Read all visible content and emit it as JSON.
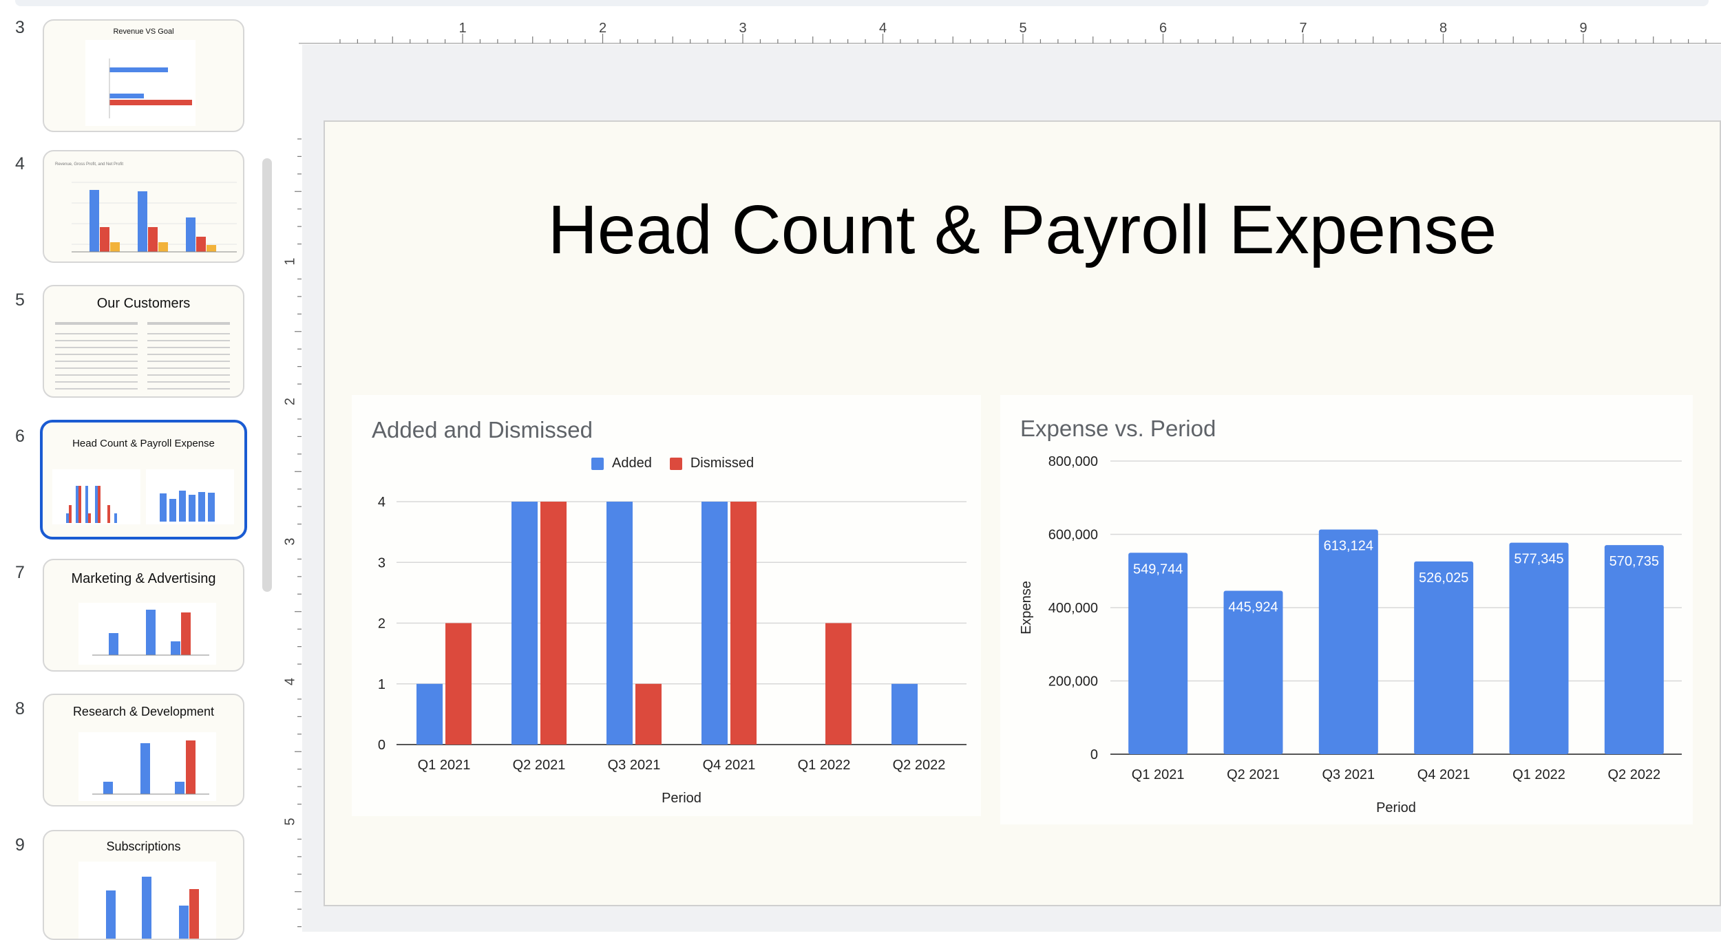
{
  "slides": [
    {
      "number": "3",
      "title": "Revenue VS Goal"
    },
    {
      "number": "4",
      "title": ""
    },
    {
      "number": "5",
      "title": "Our Customers"
    },
    {
      "number": "6",
      "title": "Head Count & Payroll Expense"
    },
    {
      "number": "7",
      "title": "Marketing & Advertising"
    },
    {
      "number": "8",
      "title": "Research & Development"
    },
    {
      "number": "9",
      "title": "Subscriptions"
    }
  ],
  "ruler": {
    "horizontal": [
      "1",
      "2",
      "3",
      "4",
      "5",
      "6",
      "7",
      "8",
      "9"
    ],
    "vertical": [
      "1",
      "2",
      "3",
      "4",
      "5"
    ]
  },
  "slide": {
    "title": "Head Count & Payroll Expense"
  },
  "colors": {
    "blue": "#4e86e8",
    "red": "#dc4a3d",
    "selected_border": "#1a5bd2"
  },
  "chart_data": [
    {
      "type": "bar",
      "title": "Added and Dismissed",
      "xlabel": "Period",
      "ylabel": "",
      "categories": [
        "Q1 2021",
        "Q2 2021",
        "Q3 2021",
        "Q4 2021",
        "Q1 2022",
        "Q2 2022"
      ],
      "series": [
        {
          "name": "Added",
          "values": [
            1,
            4,
            4,
            4,
            0,
            1
          ]
        },
        {
          "name": "Dismissed",
          "values": [
            2,
            4,
            1,
            4,
            2,
            0
          ]
        }
      ],
      "ylim": [
        0,
        4
      ],
      "yticks": [
        "0",
        "1",
        "2",
        "3",
        "4"
      ],
      "legend": "top"
    },
    {
      "type": "bar",
      "title": "Expense vs. Period",
      "xlabel": "Period",
      "ylabel": "Expense",
      "categories": [
        "Q1 2021",
        "Q2 2021",
        "Q3 2021",
        "Q4 2021",
        "Q1 2022",
        "Q2 2022"
      ],
      "values": [
        549744,
        445924,
        613124,
        526025,
        577345,
        570735
      ],
      "data_labels": [
        "549,744",
        "445,924",
        "613,124",
        "526,025",
        "577,345",
        "570,735"
      ],
      "ylim": [
        0,
        800000
      ],
      "yticks": [
        "0",
        "200,000",
        "400,000",
        "600,000",
        "800,000"
      ],
      "legend": "none"
    }
  ]
}
